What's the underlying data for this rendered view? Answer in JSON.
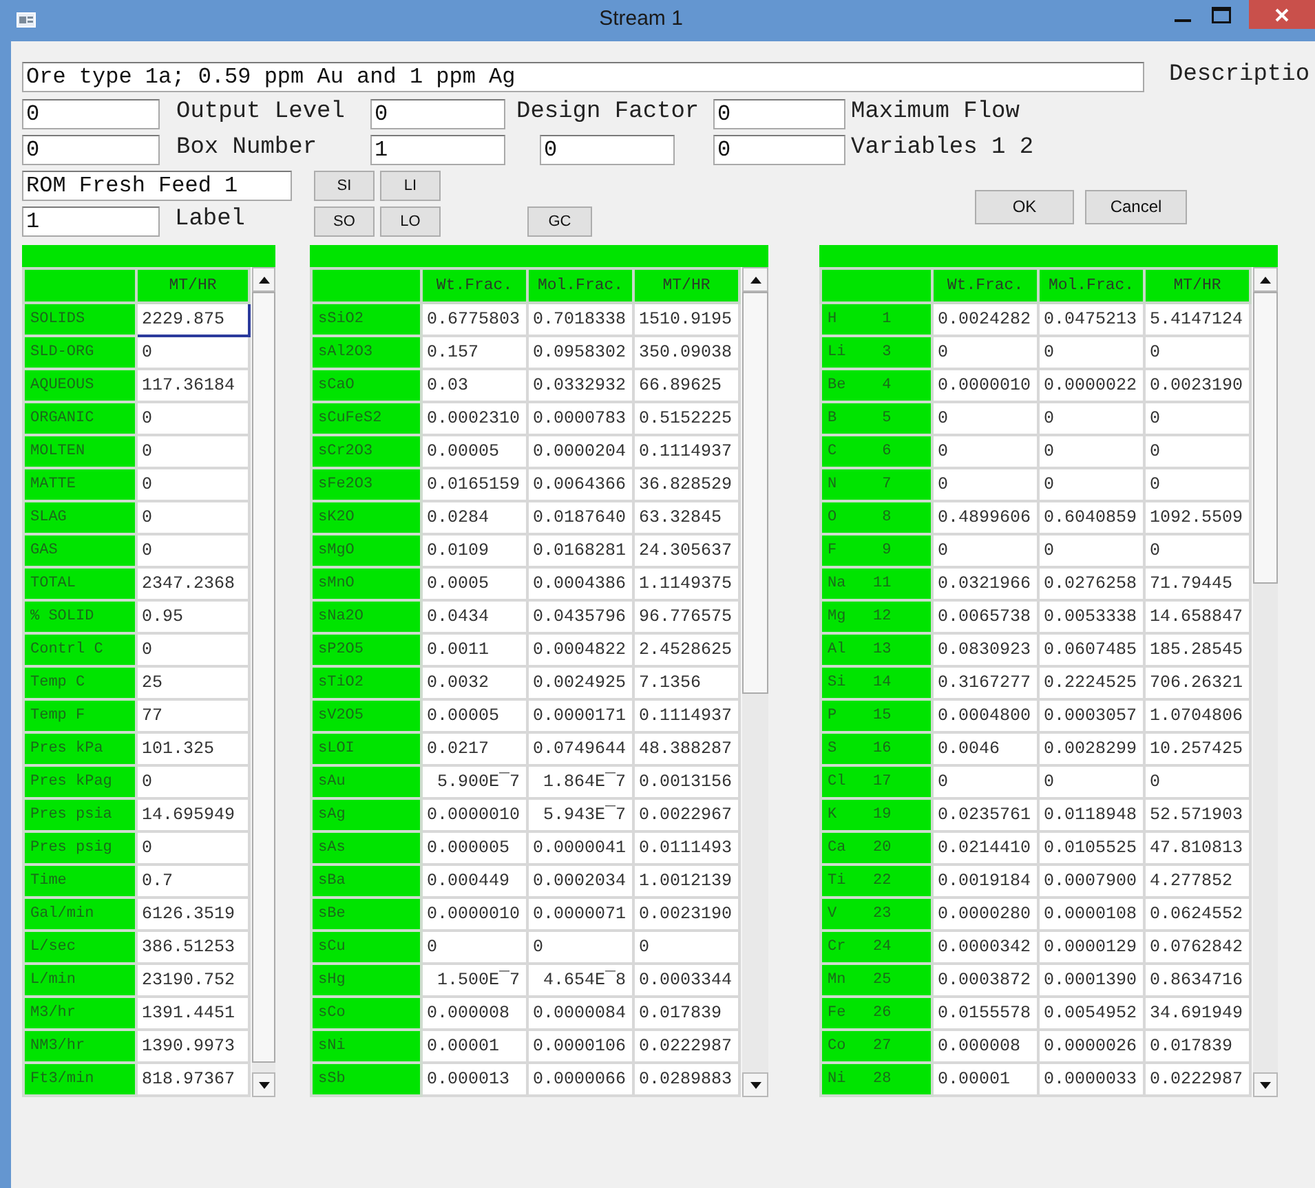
{
  "window": {
    "title": "Stream 1"
  },
  "description": {
    "value": "Ore type 1a; 0.59 ppm Au and 1 ppm Ag",
    "label": "Descriptio"
  },
  "form_rows": [
    {
      "items": [
        {
          "kind": "input",
          "value": "0"
        },
        {
          "kind": "label",
          "text": "Output Level"
        },
        {
          "kind": "input",
          "value": "0"
        },
        {
          "kind": "label",
          "text": "Design Factor"
        },
        {
          "kind": "input",
          "value": "0"
        },
        {
          "kind": "label",
          "text": "Maximum Flow"
        }
      ]
    },
    {
      "items": [
        {
          "kind": "input",
          "value": "0"
        },
        {
          "kind": "label",
          "text": "Box Number"
        },
        {
          "kind": "input",
          "value": "1"
        },
        {
          "kind": "input",
          "value": "0"
        },
        {
          "kind": "input",
          "value": "0"
        },
        {
          "kind": "label",
          "text": "Variables 1 2"
        }
      ]
    }
  ],
  "name_field": {
    "value": "ROM Fresh Feed 1"
  },
  "label_field": {
    "value": "1",
    "label": "Label"
  },
  "buttons": [
    {
      "label": "SI"
    },
    {
      "label": "LI"
    },
    {
      "label": "SO"
    },
    {
      "label": "LO"
    },
    {
      "label": "GC"
    }
  ],
  "dialog_buttons": [
    {
      "label": "OK"
    },
    {
      "label": "Cancel"
    }
  ],
  "tables": [
    {
      "columns": [
        "MT/HR"
      ],
      "rows": [
        {
          "label": "SOLIDS",
          "values": [
            "2229.875"
          ],
          "focused": true
        },
        {
          "label": "SLD-ORG",
          "values": [
            "0"
          ],
          "focused": false
        },
        {
          "label": "AQUEOUS",
          "values": [
            "117.36184"
          ],
          "focused": false
        },
        {
          "label": "ORGANIC",
          "values": [
            "0"
          ],
          "focused": false
        },
        {
          "label": "MOLTEN",
          "values": [
            "0"
          ],
          "focused": false
        },
        {
          "label": "MATTE",
          "values": [
            "0"
          ],
          "focused": false
        },
        {
          "label": "SLAG",
          "values": [
            "0"
          ],
          "focused": false
        },
        {
          "label": "GAS",
          "values": [
            "0"
          ],
          "focused": false
        },
        {
          "label": "TOTAL",
          "values": [
            "2347.2368"
          ],
          "focused": false
        },
        {
          "label": "% SOLID",
          "values": [
            "0.95"
          ],
          "focused": false
        },
        {
          "label": "Contrl C",
          "values": [
            "0"
          ],
          "focused": false
        },
        {
          "label": "Temp C",
          "values": [
            "25"
          ],
          "focused": false
        },
        {
          "label": "Temp F",
          "values": [
            "77"
          ],
          "focused": false
        },
        {
          "label": "Pres kPa",
          "values": [
            "101.325"
          ],
          "focused": false
        },
        {
          "label": "Pres kPag",
          "values": [
            "0"
          ],
          "focused": false
        },
        {
          "label": "Pres psia",
          "values": [
            "14.695949"
          ],
          "focused": false
        },
        {
          "label": "Pres psig",
          "values": [
            "0"
          ],
          "focused": false
        },
        {
          "label": "Time",
          "values": [
            "0.7"
          ],
          "focused": false
        },
        {
          "label": "Gal/min",
          "values": [
            "6126.3519"
          ],
          "focused": false
        },
        {
          "label": "L/sec",
          "values": [
            "386.51253"
          ],
          "focused": false
        },
        {
          "label": "L/min",
          "values": [
            "23190.752"
          ],
          "focused": false
        },
        {
          "label": "M3/hr",
          "values": [
            "1391.4451"
          ],
          "focused": false
        },
        {
          "label": "NM3/hr",
          "values": [
            "1390.9973"
          ],
          "focused": false
        },
        {
          "label": "Ft3/min",
          "values": [
            "818.97367"
          ],
          "focused": false
        }
      ]
    },
    {
      "columns": [
        "Wt.Frac.",
        "Mol.Frac.",
        "MT/HR"
      ],
      "rows": [
        {
          "label": "sSiO2",
          "values": [
            "0.6775803",
            "0.7018338",
            "1510.9195"
          ]
        },
        {
          "label": "sAl2O3",
          "values": [
            "0.157",
            "0.0958302",
            "350.09038"
          ]
        },
        {
          "label": "sCaO",
          "values": [
            "0.03",
            "0.0332932",
            "66.89625"
          ]
        },
        {
          "label": "sCuFeS2",
          "values": [
            "0.0002310",
            "0.0000783",
            "0.5152225"
          ]
        },
        {
          "label": "sCr2O3",
          "values": [
            "0.00005",
            "0.0000204",
            "0.1114937"
          ]
        },
        {
          "label": "sFe2O3",
          "values": [
            "0.0165159",
            "0.0064366",
            "36.828529"
          ]
        },
        {
          "label": "sK2O",
          "values": [
            "0.0284",
            "0.0187640",
            "63.32845"
          ]
        },
        {
          "label": "sMgO",
          "values": [
            "0.0109",
            "0.0168281",
            "24.305637"
          ]
        },
        {
          "label": "sMnO",
          "values": [
            "0.0005",
            "0.0004386",
            "1.1149375"
          ]
        },
        {
          "label": "sNa2O",
          "values": [
            "0.0434",
            "0.0435796",
            "96.776575"
          ]
        },
        {
          "label": "sP2O5",
          "values": [
            "0.0011",
            "0.0004822",
            "2.4528625"
          ]
        },
        {
          "label": "sTiO2",
          "values": [
            "0.0032",
            "0.0024925",
            "7.1356"
          ]
        },
        {
          "label": "sV2O5",
          "values": [
            "0.00005",
            "0.0000171",
            "0.1114937"
          ]
        },
        {
          "label": "sLOI",
          "values": [
            "0.0217",
            "0.0749644",
            "48.388287"
          ]
        },
        {
          "label": "sAu",
          "values": [
            " 5.900E¯7",
            " 1.864E¯7",
            "0.0013156"
          ]
        },
        {
          "label": "sAg",
          "values": [
            "0.0000010",
            " 5.943E¯7",
            "0.0022967"
          ]
        },
        {
          "label": "sAs",
          "values": [
            "0.000005",
            "0.0000041",
            "0.0111493"
          ]
        },
        {
          "label": "sBa",
          "values": [
            "0.000449",
            "0.0002034",
            "1.0012139"
          ]
        },
        {
          "label": "sBe",
          "values": [
            "0.0000010",
            "0.0000071",
            "0.0023190"
          ]
        },
        {
          "label": "sCu",
          "values": [
            "0",
            "0",
            "0"
          ]
        },
        {
          "label": "sHg",
          "values": [
            " 1.500E¯7",
            " 4.654E¯8",
            "0.0003344"
          ]
        },
        {
          "label": "sCo",
          "values": [
            "0.000008",
            "0.0000084",
            "0.017839"
          ]
        },
        {
          "label": "sNi",
          "values": [
            "0.00001",
            "0.0000106",
            "0.0222987"
          ]
        },
        {
          "label": "sSb",
          "values": [
            "0.000013",
            "0.0000066",
            "0.0289883"
          ]
        }
      ]
    },
    {
      "columns": [
        "Wt.Frac.",
        "Mol.Frac.",
        "MT/HR"
      ],
      "rows": [
        {
          "label": "H     1",
          "values": [
            "0.0024282",
            "0.0475213",
            "5.4147124"
          ]
        },
        {
          "label": "Li    3",
          "values": [
            "0",
            "0",
            "0"
          ]
        },
        {
          "label": "Be    4",
          "values": [
            "0.0000010",
            "0.0000022",
            "0.0023190"
          ]
        },
        {
          "label": "B     5",
          "values": [
            "0",
            "0",
            "0"
          ]
        },
        {
          "label": "C     6",
          "values": [
            "0",
            "0",
            "0"
          ]
        },
        {
          "label": "N     7",
          "values": [
            "0",
            "0",
            "0"
          ]
        },
        {
          "label": "O     8",
          "values": [
            "0.4899606",
            "0.6040859",
            "1092.5509"
          ]
        },
        {
          "label": "F     9",
          "values": [
            "0",
            "0",
            "0"
          ]
        },
        {
          "label": "Na   11",
          "values": [
            "0.0321966",
            "0.0276258",
            "71.79445"
          ]
        },
        {
          "label": "Mg   12",
          "values": [
            "0.0065738",
            "0.0053338",
            "14.658847"
          ]
        },
        {
          "label": "Al   13",
          "values": [
            "0.0830923",
            "0.0607485",
            "185.28545"
          ]
        },
        {
          "label": "Si   14",
          "values": [
            "0.3167277",
            "0.2224525",
            "706.26321"
          ]
        },
        {
          "label": "P    15",
          "values": [
            "0.0004800",
            "0.0003057",
            "1.0704806"
          ]
        },
        {
          "label": "S    16",
          "values": [
            "0.0046",
            "0.0028299",
            "10.257425"
          ]
        },
        {
          "label": "Cl   17",
          "values": [
            "0",
            "0",
            "0"
          ]
        },
        {
          "label": "K    19",
          "values": [
            "0.0235761",
            "0.0118948",
            "52.571903"
          ]
        },
        {
          "label": "Ca   20",
          "values": [
            "0.0214410",
            "0.0105525",
            "47.810813"
          ]
        },
        {
          "label": "Ti   22",
          "values": [
            "0.0019184",
            "0.0007900",
            "4.277852"
          ]
        },
        {
          "label": "V    23",
          "values": [
            "0.0000280",
            "0.0000108",
            "0.0624552"
          ]
        },
        {
          "label": "Cr   24",
          "values": [
            "0.0000342",
            "0.0000129",
            "0.0762842"
          ]
        },
        {
          "label": "Mn   25",
          "values": [
            "0.0003872",
            "0.0001390",
            "0.8634716"
          ]
        },
        {
          "label": "Fe   26",
          "values": [
            "0.0155578",
            "0.0054952",
            "34.691949"
          ]
        },
        {
          "label": "Co   27",
          "values": [
            "0.000008",
            "0.0000026",
            "0.017839"
          ]
        },
        {
          "label": "Ni   28",
          "values": [
            "0.00001",
            "0.0000033",
            "0.0222987"
          ]
        }
      ]
    }
  ]
}
